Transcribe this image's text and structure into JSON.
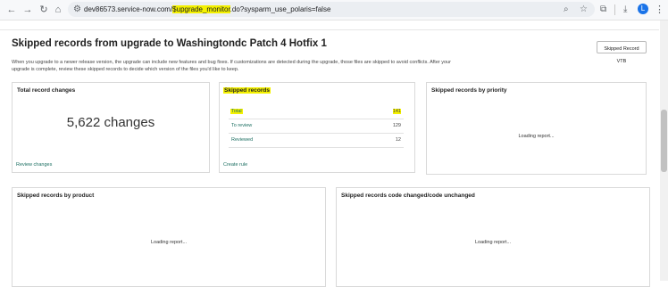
{
  "browser": {
    "url_prefix": "dev86573.service-now.com/",
    "url_highlight": "$upgrade_monitor",
    "url_suffix": ".do?sysparm_use_polaris=false",
    "avatar_initial": "L"
  },
  "page": {
    "title": "Skipped records from upgrade to Washingtondc Patch 4 Hotfix 1",
    "vtb_button": "Skipped Record VTB",
    "description": "When you upgrade to a newer release version, the upgrade can include new features and bug fixes. If customizations are detected during the upgrade, those files are skipped to avoid conflicts. After your upgrade is complete, review these skipped records to decide which version of the files you'd like to keep."
  },
  "cards": {
    "total_changes": {
      "title": "Total record changes",
      "count": "5,622 changes",
      "link": "Review changes"
    },
    "skipped": {
      "title": "Skipped records",
      "rows": [
        {
          "label": "Total",
          "value": "141"
        },
        {
          "label": "To review",
          "value": "129"
        },
        {
          "label": "Reviewed",
          "value": "12"
        }
      ],
      "link": "Create rule"
    },
    "by_priority": {
      "title": "Skipped records by priority",
      "loading": "Loading report..."
    },
    "by_product": {
      "title": "Skipped records by product",
      "loading": "Loading report..."
    },
    "code_changed": {
      "title": "Skipped records code changed/code unchanged",
      "loading": "Loading report..."
    }
  }
}
